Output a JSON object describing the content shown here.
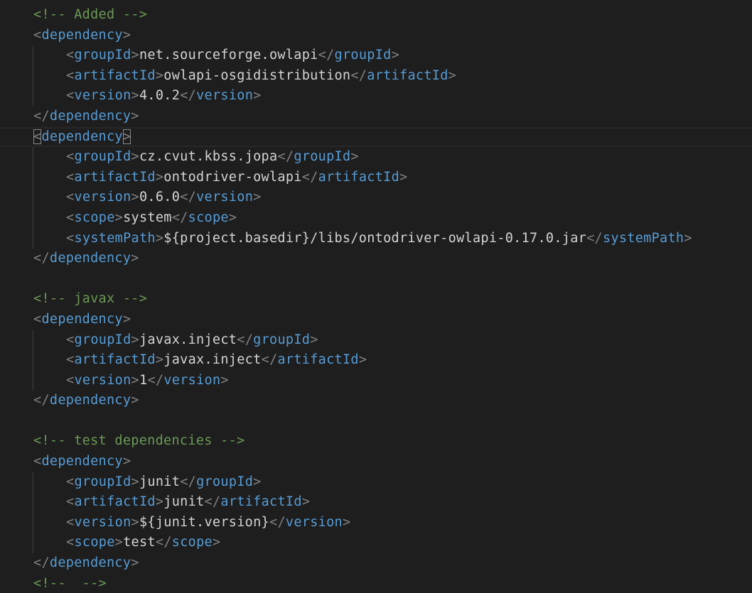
{
  "editor": {
    "lines": [
      {
        "kind": "comment",
        "text": "<!-- Added -->"
      },
      {
        "kind": "open",
        "tag": "dependency"
      },
      {
        "kind": "element",
        "tag": "groupId",
        "value": "net.sourceforge.owlapi"
      },
      {
        "kind": "element",
        "tag": "artifactId",
        "value": "owlapi-osgidistribution"
      },
      {
        "kind": "element",
        "tag": "version",
        "value": "4.0.2"
      },
      {
        "kind": "close",
        "tag": "dependency"
      },
      {
        "kind": "open",
        "tag": "dependency",
        "current": true
      },
      {
        "kind": "element",
        "tag": "groupId",
        "value": "cz.cvut.kbss.jopa"
      },
      {
        "kind": "element",
        "tag": "artifactId",
        "value": "ontodriver-owlapi"
      },
      {
        "kind": "element",
        "tag": "version",
        "value": "0.6.0"
      },
      {
        "kind": "element",
        "tag": "scope",
        "value": "system"
      },
      {
        "kind": "element",
        "tag": "systemPath",
        "value": "${project.basedir}/libs/ontodriver-owlapi-0.17.0.jar"
      },
      {
        "kind": "close",
        "tag": "dependency"
      },
      {
        "kind": "blank"
      },
      {
        "kind": "comment",
        "text": "<!-- javax -->"
      },
      {
        "kind": "open",
        "tag": "dependency"
      },
      {
        "kind": "element",
        "tag": "groupId",
        "value": "javax.inject"
      },
      {
        "kind": "element",
        "tag": "artifactId",
        "value": "javax.inject"
      },
      {
        "kind": "element",
        "tag": "version",
        "value": "1"
      },
      {
        "kind": "close",
        "tag": "dependency"
      },
      {
        "kind": "blank"
      },
      {
        "kind": "comment",
        "text": "<!-- test dependencies -->"
      },
      {
        "kind": "open",
        "tag": "dependency"
      },
      {
        "kind": "element",
        "tag": "groupId",
        "value": "junit"
      },
      {
        "kind": "element",
        "tag": "artifactId",
        "value": "junit"
      },
      {
        "kind": "element",
        "tag": "version",
        "value": "${junit.version}"
      },
      {
        "kind": "element",
        "tag": "scope",
        "value": "test"
      },
      {
        "kind": "close",
        "tag": "dependency"
      },
      {
        "kind": "comment",
        "text": "<!--  -->"
      }
    ]
  },
  "colors": {
    "background": "#1e1e1e",
    "tag": "#569cd6",
    "bracket": "#808080",
    "text": "#d4d4d4",
    "comment": "#6a9955"
  }
}
